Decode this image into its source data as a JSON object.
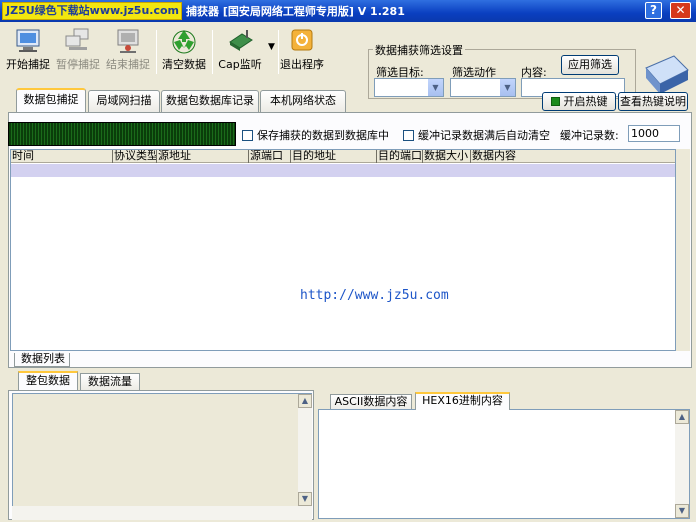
{
  "window": {
    "watermark": "JZ5U绿色下载站www.jz5u.com",
    "title": "捕获器 [国安局网络工程师专用版] V 1.281",
    "help_label": "?",
    "close_label": "✕"
  },
  "toolbar": {
    "start_capture": "开始捕捉",
    "pause_capture": "暂停捕捉",
    "stop_capture": "结束捕捉",
    "clear_data": "清空数据",
    "cap_monitor": "Cap监听",
    "exit_program": "退出程序"
  },
  "filter": {
    "title": "数据捕获筛选设置",
    "target_label": "筛选目标:",
    "action_label": "筛选动作",
    "content_label": "内容:",
    "apply_button": "应用筛选",
    "target_value": "",
    "action_value": "",
    "content_value": ""
  },
  "tabs": [
    {
      "label": "数据包捕捉"
    },
    {
      "label": "局域网扫描"
    },
    {
      "label": "数据包数据库记录"
    },
    {
      "label": "本机网络状态"
    }
  ],
  "hotkey": {
    "enable_label": "开启热键",
    "view_label": "查看热键说明"
  },
  "options": {
    "save_to_db": "保存捕获的数据到数据库中",
    "auto_clear": "缓冲记录数据满后自动清空",
    "buffer_label": "缓冲记录数:",
    "buffer_value": "1000"
  },
  "grid": {
    "columns": [
      "时间",
      "协议类型",
      "源地址",
      "源端口",
      "目的地址",
      "目的端口",
      "数据大小",
      "数据内容"
    ],
    "rows": [],
    "watermark": "http://www.jz5u.com"
  },
  "subtab": "数据列表",
  "bottom_tabs": [
    {
      "label": "整包数据"
    },
    {
      "label": "数据流量"
    }
  ],
  "right_tabs": [
    {
      "label": "ASCII数据内容"
    },
    {
      "label": "HEX16进制内容"
    }
  ]
}
